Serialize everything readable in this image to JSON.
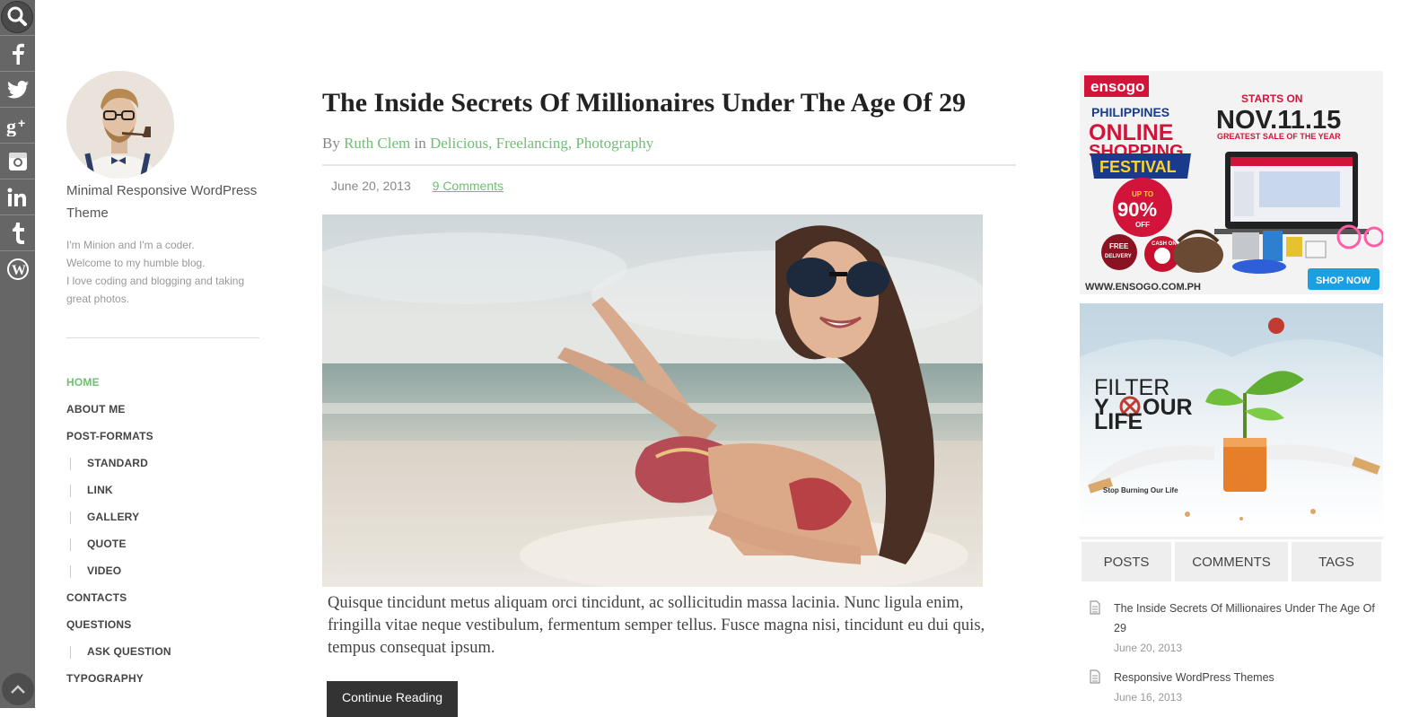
{
  "social": {
    "icons": [
      "search-icon",
      "facebook-icon",
      "twitter-icon",
      "google-plus-icon",
      "instagram-icon",
      "linkedin-icon",
      "tumblr-icon",
      "wordpress-icon"
    ],
    "up_icon": "arrow-up-icon",
    "bar_color": "#666666"
  },
  "profile": {
    "site_title": "Minimal Responsive WordPress Theme",
    "description_lines": [
      "I'm Minion and I'm a coder.",
      "Welcome to my humble blog.",
      "I love coding and blogging and taking",
      "great photos."
    ]
  },
  "nav": {
    "items": [
      {
        "label": "HOME",
        "active": true,
        "sub": false
      },
      {
        "label": "ABOUT ME",
        "active": false,
        "sub": false
      },
      {
        "label": "POST-FORMATS",
        "active": false,
        "sub": false
      },
      {
        "label": "STANDARD",
        "active": false,
        "sub": true
      },
      {
        "label": "LINK",
        "active": false,
        "sub": true
      },
      {
        "label": "GALLERY",
        "active": false,
        "sub": true
      },
      {
        "label": "QUOTE",
        "active": false,
        "sub": true
      },
      {
        "label": "VIDEO",
        "active": false,
        "sub": true
      },
      {
        "label": "CONTACTS",
        "active": false,
        "sub": false
      },
      {
        "label": "QUESTIONS",
        "active": false,
        "sub": false
      },
      {
        "label": "ASK QUESTION",
        "active": false,
        "sub": true
      },
      {
        "label": "TYPOGRAPHY",
        "active": false,
        "sub": false
      }
    ]
  },
  "post": {
    "title": "The Inside Secrets Of Millionaires Under The Age Of 29",
    "by": "By",
    "author": "Ruth Clem",
    "in": "in",
    "categories": [
      "Delicious",
      "Freelancing",
      "Photography"
    ],
    "date": "June 20, 2013",
    "comments": "9 Comments",
    "excerpt": "Quisque tincidunt metus aliquam orci tincidunt, ac sollicitudin massa lacinia. Nunc ligula enim, fringilla vitae neque vestibulum, fermentum semper tellus. Fusce magna nisi, tincidunt eu dui quis, tempus consequat ipsum.",
    "continue_label": "Continue Reading"
  },
  "ads": {
    "ad1": {
      "brand": "ensogo",
      "line1": "PHILIPPINES",
      "line2": "ONLINE",
      "line3": "SHOPPING",
      "line4": "FESTIVAL",
      "starts": "STARTS ON",
      "date": "NOV.11.15",
      "tagline": "GREATEST SALE OF THE YEAR",
      "upto": "UP TO",
      "percent": "90%",
      "off": "OFF",
      "free": "FREE",
      "delivery": "DELIVERY",
      "cod": "CASH ON",
      "url": "WWW.ENSOGO.COM.PH",
      "shop": "SHOP NOW"
    },
    "ad2": {
      "line1": "FILTER",
      "line2a": "Y",
      "line2b": "OUR",
      "line3": "LIFE",
      "caption": "Stop Burning Our Life"
    }
  },
  "tabs": [
    {
      "label": "POSTS"
    },
    {
      "label": "COMMENTS"
    },
    {
      "label": "TAGS"
    }
  ],
  "recent_posts": [
    {
      "title": "The Inside Secrets Of Millionaires Under The Age Of 29",
      "date": "June 20, 2013"
    },
    {
      "title": "Responsive WordPress Themes",
      "date": "June 16, 2013"
    }
  ],
  "colors": {
    "accent_green": "#6fbf73",
    "dark_button": "#333333",
    "tab_bg": "#eeeeee"
  }
}
